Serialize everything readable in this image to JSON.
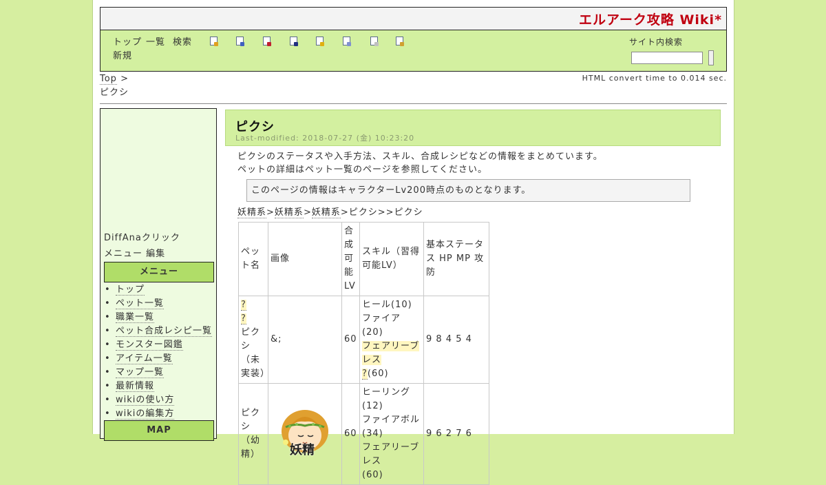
{
  "site": {
    "title": "エルアーク攻略 Wiki*"
  },
  "toolbar": {
    "links": [
      "トップ",
      "一覧",
      "検索",
      "新規"
    ],
    "icons": [
      "new-page-icon",
      "rename-icon",
      "diff-icon",
      "backup-icon",
      "freeze-icon",
      "copy-icon",
      "list-icon",
      "help-icon"
    ],
    "search_label": "サイト内検索",
    "search_value": ""
  },
  "breadcrumb": {
    "top": "Top",
    "sep": ">",
    "current": "ピクシ"
  },
  "convert_time": "HTML convert time to 0.014 sec.",
  "sidebar": {
    "line1": "DiffAnaクリック",
    "line2": "メニュー 編集",
    "menu_heading": "メニュー",
    "items": [
      "トップ",
      "ペット一覧",
      "職業一覧",
      "ペット合成レシピ一覧",
      "モンスター図鑑",
      "アイテム一覧",
      "マップ一覧",
      "最新情報",
      "wikiの使い方",
      "wikiの編集方"
    ],
    "map_heading": "MAP"
  },
  "page": {
    "title": "ピクシ",
    "last_modified": "Last-modified: 2018-07-27 (金) 10:23:20",
    "intro_line1": "ピクシのステータスや入手方法、スキル、合成レシピなどの情報をまとめています。",
    "intro_line2": "ペットの詳細はペット一覧のページを参照してください。",
    "notice": "このページの情報はキャラクターLv200時点のものとなります。",
    "path": [
      "妖精系",
      "妖精系",
      "妖精系",
      "ピクシ",
      "ピクシ"
    ],
    "path_seps": [
      ">",
      ">",
      ">",
      ">>"
    ]
  },
  "table": {
    "headers": {
      "name": "ペット名",
      "image": "画像",
      "level": "合成可能LV",
      "skills": "スキル（習得可能LV）",
      "stats": "基本ステータス HP MP 攻 防"
    },
    "rows": [
      {
        "name_q1": "?",
        "name_q2": "?",
        "name_text": "ピクシ（未実装）",
        "image_text": "&;",
        "level": "60",
        "skill1": "ヒール(10)",
        "skill2": "ファイア(20)",
        "skill3_hl": "フェアリーブレス",
        "skill3_q": "?",
        "skill3_lv": "(60)",
        "stats": "9 8 4 5 4"
      },
      {
        "name_text": "ピクシ（幼精）",
        "image_label": "妖精",
        "level": "60",
        "skill1": "ヒーリング",
        "skill1_lv": "(12)",
        "skill2": "ファイアボル",
        "skill2_lv": "(34)",
        "skill3": "フェアリーブレス",
        "skill3_lv": "(60)",
        "stats": "9 6 2 7 6"
      }
    ]
  }
}
